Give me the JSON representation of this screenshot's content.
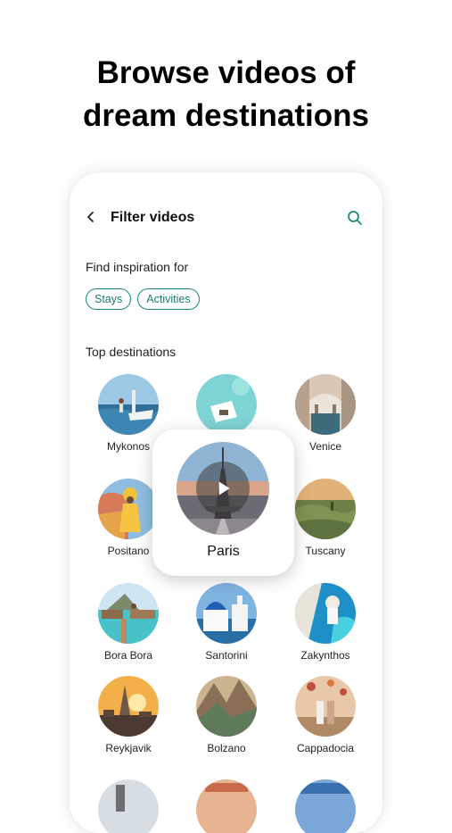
{
  "headline": {
    "line1": "Browse videos of",
    "line2": "dream destinations"
  },
  "header": {
    "title": "Filter videos",
    "back_icon": "chevron-left-icon",
    "search_icon": "search-icon"
  },
  "inspiration": {
    "label": "Find inspiration for",
    "chips": [
      "Stays",
      "Activities"
    ]
  },
  "top_destinations": {
    "label": "Top destinations",
    "items": [
      "Mykonos",
      "",
      "Venice",
      "Positano",
      "Tuscany",
      "Bora Bora",
      "Santorini",
      "Zakynthos",
      "Reykjavik",
      "Bolzano",
      "Cappadocia"
    ]
  },
  "featured": {
    "label": "Paris",
    "icon": "play-icon"
  },
  "colors": {
    "accent": "#1a8a78",
    "background": "#ffffff"
  }
}
